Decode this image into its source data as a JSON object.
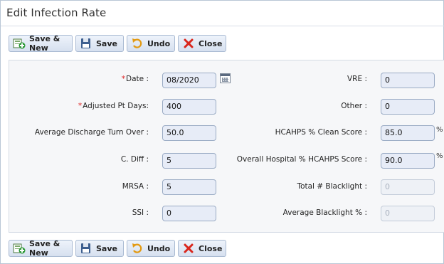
{
  "window": {
    "title": "Edit Infection Rate"
  },
  "toolbar": {
    "save_new_label": "Save & New",
    "save_label": "Save",
    "undo_label": "Undo",
    "close_label": "Close"
  },
  "form": {
    "left": [
      {
        "label": "Date :",
        "required": true,
        "value": "08/2020"
      },
      {
        "label": "Adjusted Pt Days:",
        "required": true,
        "value": "400"
      },
      {
        "label": "Average Discharge Turn Over :",
        "value": "50.0"
      },
      {
        "label": "C. Diff :",
        "value": "5"
      },
      {
        "label": "MRSA :",
        "value": "5"
      },
      {
        "label": "SSI :",
        "value": "0"
      }
    ],
    "right": [
      {
        "label": "VRE :",
        "value": "0"
      },
      {
        "label": "Other :",
        "value": "0"
      },
      {
        "label": "HCAHPS % Clean Score :",
        "value": "85.0",
        "suffix": "%"
      },
      {
        "label": "Overall Hospital % HCAHPS Score :",
        "value": "90.0",
        "suffix": "%"
      },
      {
        "label": "Total # Blacklight :",
        "value": "0",
        "disabled": true
      },
      {
        "label": "Average Blacklight % :",
        "value": "0",
        "disabled": true
      }
    ],
    "required_marker": "*"
  },
  "icons": {
    "save_new": "save-new-icon",
    "save": "floppy-disk-icon",
    "undo": "undo-arrow-icon",
    "close": "red-x-icon",
    "calendar": "calendar-icon"
  },
  "colors": {
    "button_bg": "#d6e0ef",
    "input_bg": "#e7ecf7",
    "required": "#dd2222",
    "close_icon": "#d9261c"
  }
}
